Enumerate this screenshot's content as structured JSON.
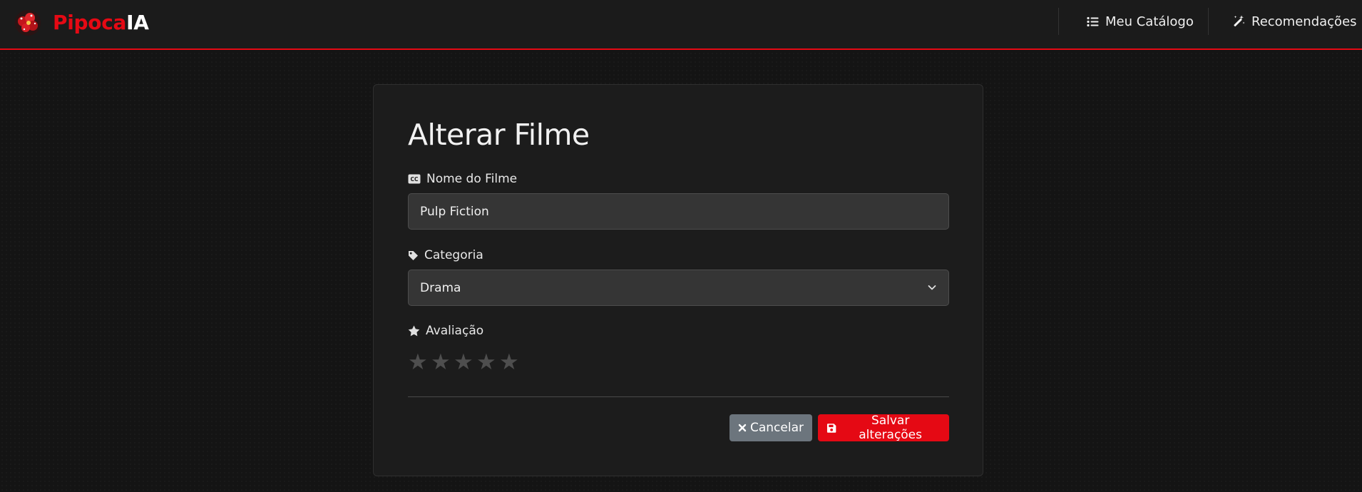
{
  "brand": {
    "name_red": "Pipoca",
    "name_white": "IA",
    "logo_icon": "popcorn-icon"
  },
  "nav": {
    "catalog": {
      "label": "Meu Catálogo",
      "icon": "list-icon"
    },
    "recommendations": {
      "label": "Recomendações",
      "icon": "magic-wand-icon"
    }
  },
  "form": {
    "title": "Alterar Filme",
    "name": {
      "label": "Nome do Filme",
      "icon": "closed-caption-icon",
      "value": "Pulp Fiction"
    },
    "category": {
      "label": "Categoria",
      "icon": "tag-icon",
      "value": "Drama"
    },
    "rating": {
      "label": "Avaliação",
      "icon": "star-icon",
      "max": 5,
      "value": 0,
      "star_glyph": "★"
    },
    "cancel_label": "Cancelar",
    "save_label": "Salvar alterações"
  },
  "colors": {
    "accent": "#e50914",
    "background": "#141414",
    "card": "#1c1c1c",
    "cancel": "#6c757d",
    "star_empty": "#4e4e4e"
  }
}
